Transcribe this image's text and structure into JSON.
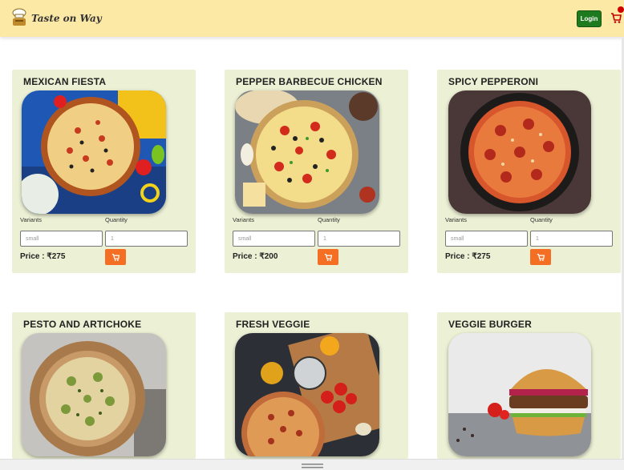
{
  "app": {
    "brand_name": "Taste on Way"
  },
  "header": {
    "login_label": "Login"
  },
  "form_labels": {
    "variants": "Variants",
    "quantity": "Quantity",
    "price_prefix": "Price : "
  },
  "products": [
    {
      "name": "MEXICAN FIESTA",
      "variant_placeholder": "small",
      "quantity_placeholder": "1",
      "price": "₹275"
    },
    {
      "name": "PEPPER BARBECUE CHICKEN",
      "variant_placeholder": "small",
      "quantity_placeholder": "1",
      "price": "₹200"
    },
    {
      "name": "SPICY PEPPERONI",
      "variant_placeholder": "small",
      "quantity_placeholder": "1",
      "price": "₹275"
    },
    {
      "name": "PESTO AND ARTICHOKE"
    },
    {
      "name": "FRESH VEGGIE"
    },
    {
      "name": "VEGGIE BURGER"
    }
  ],
  "colors": {
    "navbar": "#fde9a6",
    "card": "#ecf0d4",
    "login": "#1e7a1e",
    "cart_button": "#f46f23"
  }
}
